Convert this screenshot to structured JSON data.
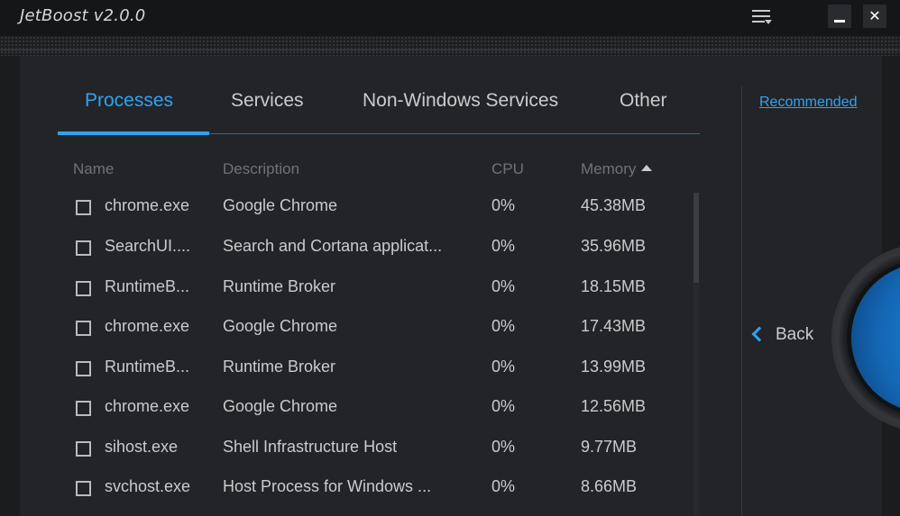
{
  "window": {
    "title": "JetBoost v2.0.0"
  },
  "tabs": [
    {
      "label": "Processes",
      "active": true
    },
    {
      "label": "Services",
      "active": false
    },
    {
      "label": "Non-Windows Services",
      "active": false
    },
    {
      "label": "Other",
      "active": false
    }
  ],
  "table": {
    "columns": {
      "name": "Name",
      "description": "Description",
      "cpu": "CPU",
      "memory": "Memory"
    },
    "sort": {
      "column": "memory",
      "direction": "ascending-arrow"
    },
    "rows": [
      {
        "name": "chrome.exe",
        "description": "Google Chrome",
        "cpu": "0%",
        "memory": "45.38MB",
        "checked": false
      },
      {
        "name": "SearchUI....",
        "description": "Search and Cortana applicat...",
        "cpu": "0%",
        "memory": "35.96MB",
        "checked": false
      },
      {
        "name": "RuntimeB...",
        "description": "Runtime Broker",
        "cpu": "0%",
        "memory": "18.15MB",
        "checked": false
      },
      {
        "name": "chrome.exe",
        "description": "Google Chrome",
        "cpu": "0%",
        "memory": "17.43MB",
        "checked": false
      },
      {
        "name": "RuntimeB...",
        "description": "Runtime Broker",
        "cpu": "0%",
        "memory": "13.99MB",
        "checked": false
      },
      {
        "name": "chrome.exe",
        "description": "Google Chrome",
        "cpu": "0%",
        "memory": "12.56MB",
        "checked": false
      },
      {
        "name": "sihost.exe",
        "description": "Shell Infrastructure Host",
        "cpu": "0%",
        "memory": "9.77MB",
        "checked": false
      },
      {
        "name": "svchost.exe",
        "description": "Host Process for Windows ...",
        "cpu": "0%",
        "memory": "8.66MB",
        "checked": false
      }
    ]
  },
  "sidebar": {
    "recommended_label": "Recommended",
    "back_label": "Back"
  },
  "colors": {
    "accent": "#2ea3f2",
    "background": "#1b1c1e",
    "panel": "#232427",
    "text": "#c9cbcd",
    "muted": "#6f7276"
  },
  "icons": {
    "menu": "menu-lines-icon",
    "minimize": "minimize-icon",
    "close": "close-icon",
    "back": "chevron-left-icon",
    "sort": "sort-up-icon",
    "checkbox": "checkbox-icon"
  }
}
